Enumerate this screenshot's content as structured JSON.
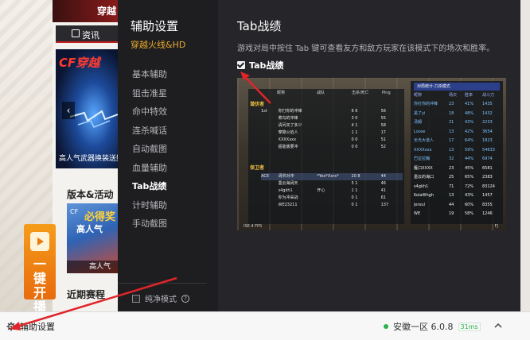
{
  "launcher": {
    "top_title": "穿越",
    "news_label": "资讯",
    "banner_logo": "CF穿越",
    "banner_caption": "高人气武器换装送好",
    "section_title": "版本&活动",
    "event_headline": "必得奖",
    "event_sub": "高人气",
    "event_caption": "高人气",
    "promo_text": "一键开播",
    "recent_title": "近期赛程"
  },
  "dialog": {
    "title": "辅助设置",
    "subtitle": "穿越火线&HD",
    "nav_items": [
      "基本辅助",
      "狙击准星",
      "命中特效",
      "连杀喊话",
      "自动截图",
      "血量辅助",
      "Tab战绩",
      "计时辅助",
      "手动截图"
    ],
    "active_item": "Tab战绩",
    "pure_mode_label": "纯净模式",
    "pure_mode_checked": false,
    "content_title": "Tab战绩",
    "content_desc": "游戏对局中按住 Tab 键可查看友方和敌方玩家在该模式下的场次和胜率。",
    "tab_checkbox_label": "Tab战绩",
    "tab_checkbox_checked": true
  },
  "preview": {
    "team1_label": "潜伏者",
    "team2_label": "保卫者",
    "headers": [
      "",
      "昵称",
      "战队",
      "击杀/死亡",
      "Ping"
    ],
    "team1_rows": [
      [
        "1st",
        "你打你的冲锋",
        "",
        "6  6",
        "56"
      ],
      [
        "",
        "菜鸟的冲锋",
        "",
        "3  0",
        "55"
      ],
      [
        "",
        "请问买了多少",
        "",
        "4  1",
        "58"
      ],
      [
        "",
        "摩擦火焰人",
        "",
        "1  1",
        "17"
      ],
      [
        "",
        "XXXXxxx",
        "",
        "0  0",
        "51"
      ],
      [
        "",
        "超能版要冲",
        "",
        "0  0",
        "52"
      ]
    ],
    "team2_rows": [
      [
        "ACE",
        "阔爷对冲",
        "*Yoo*Xxrx*",
        "20  8",
        "44"
      ],
      [
        "",
        "墨云海阔天",
        "",
        "5  1",
        "46"
      ],
      [
        "",
        "s4gkh1",
        "开心",
        "1  1",
        "41"
      ],
      [
        "",
        "你为冲采战",
        "",
        "0  1",
        "61"
      ],
      [
        "",
        "WE23211",
        "",
        "0  1",
        "137"
      ]
    ],
    "right_title": "对局统计-刀杀模式",
    "right_headers": [
      "昵称",
      "场次",
      "胜率",
      "战斗力"
    ],
    "right_rows": [
      [
        "你打你的冲锋",
        "23",
        "41%",
        "1435"
      ],
      [
        "黑了yi",
        "18",
        "48%",
        "1432"
      ],
      [
        "汤姆",
        "21",
        "43%",
        "2233"
      ],
      [
        "Loose",
        "13",
        "42%",
        "3654"
      ],
      [
        "长光大道人",
        "17",
        "64%",
        "1823"
      ],
      [
        "XXXXxxx",
        "13",
        "59%",
        "54633"
      ],
      [
        "巴拉拉胸",
        "32",
        "44%",
        "6974"
      ],
      [
        "雁口XXXX",
        "23",
        "45%",
        "6581"
      ],
      [
        "墨云的海口",
        "25",
        "65%",
        "2383"
      ],
      [
        "s4gkh1",
        "71",
        "72%",
        "83124"
      ],
      [
        "KolaWhgh",
        "13",
        "43%",
        "1457"
      ],
      [
        "Jerxul",
        "44",
        "60%",
        "8355"
      ],
      [
        "WE",
        "19",
        "58%",
        "1246"
      ]
    ],
    "bottom_left": "ISE.4 FPS",
    "bottom_right": "FJ"
  },
  "statusbar": {
    "settings_label": "辅助设置",
    "server_label": "安徽一区 6.0.8",
    "ping": "31ms"
  },
  "colors": {
    "dialog_bg": "#26262a",
    "nav_bg": "#1e1e21",
    "accent_orange": "#e8a92a",
    "status_green": "#2bb24c",
    "annotation_red": "#e0242a"
  }
}
